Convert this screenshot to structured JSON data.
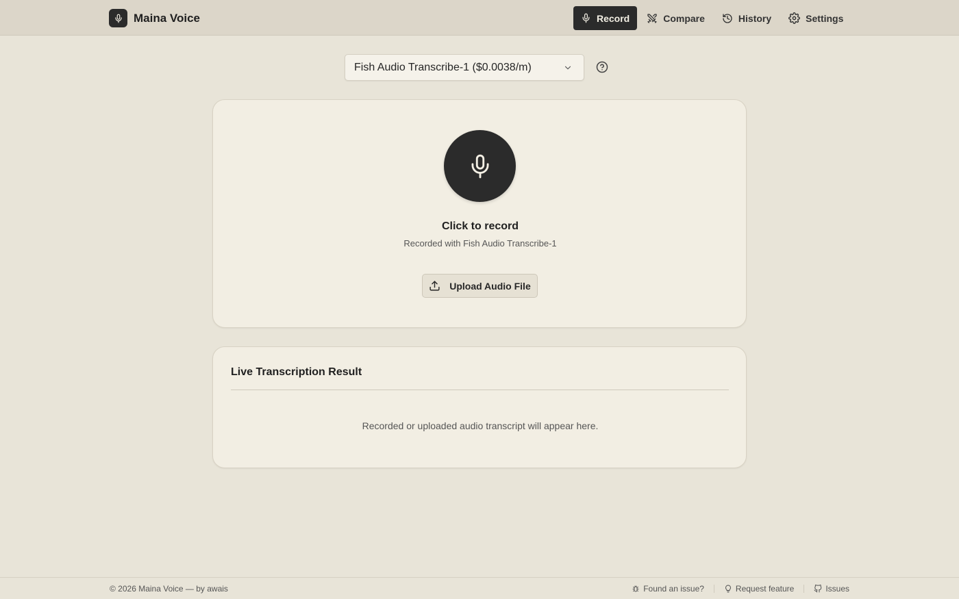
{
  "header": {
    "brand": "Maina Voice",
    "nav": [
      {
        "label": "Record",
        "icon": "mic-icon",
        "active": true
      },
      {
        "label": "Compare",
        "icon": "swords-icon",
        "active": false
      },
      {
        "label": "History",
        "icon": "history-icon",
        "active": false
      },
      {
        "label": "Settings",
        "icon": "gear-icon",
        "active": false
      }
    ]
  },
  "model_select": {
    "value": "Fish Audio Transcribe-1 ($0.0038/m)"
  },
  "record": {
    "title": "Click to record",
    "subtitle": "Recorded with Fish Audio Transcribe-1",
    "upload_label": "Upload Audio File"
  },
  "result": {
    "title": "Live Transcription Result",
    "placeholder": "Recorded or uploaded audio transcript will appear here."
  },
  "footer": {
    "copyright": "© 2026 Maina Voice — by awais",
    "links": [
      {
        "label": "Found an issue?",
        "icon": "bug-icon"
      },
      {
        "label": "Request feature",
        "icon": "lightbulb-icon"
      },
      {
        "label": "Issues",
        "icon": "github-icon"
      }
    ]
  },
  "colors": {
    "background": "#e8e4d8",
    "header": "#dcd6c9",
    "card": "#f2eee3",
    "accent_dark": "#2b2b2b"
  }
}
